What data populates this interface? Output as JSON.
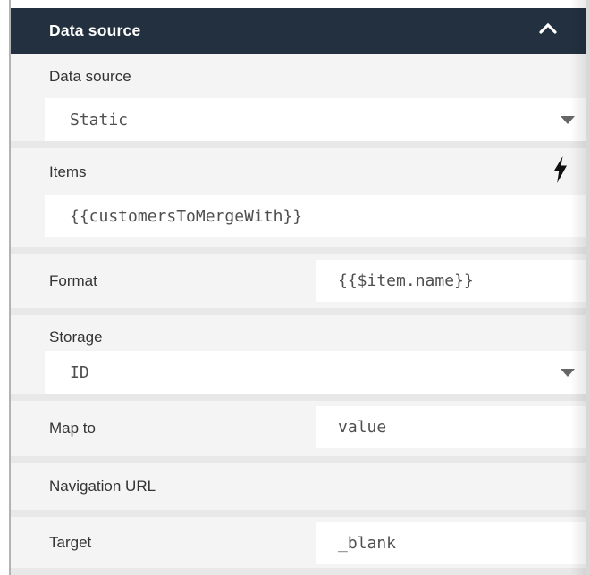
{
  "panel": {
    "header": {
      "title": "Data source",
      "icon": "chevron-up-icon"
    },
    "colors": {
      "header_bg": "#22303f",
      "header_text": "#ffffff",
      "body_bg": "#f4f4f4",
      "separator": "#e8e8e8",
      "input_bg": "#ffffff",
      "label_text": "#333333",
      "value_text": "#4f4f4f",
      "border_line": "#b3b3b3"
    },
    "fields": {
      "data_source": {
        "label": "Data source",
        "value": "Static",
        "control": "dropdown"
      },
      "items": {
        "label": "Items",
        "value": "{{customersToMergeWith}}",
        "control": "code-input",
        "icon": "lightning-bolt-icon"
      },
      "format": {
        "label": "Format",
        "value": "{{$item.name}}",
        "control": "code-input"
      },
      "storage": {
        "label": "Storage",
        "value": "ID",
        "control": "dropdown"
      },
      "map_to": {
        "label": "Map to",
        "value": "value",
        "control": "text-input"
      },
      "navigation_url": {
        "label": "Navigation URL",
        "value": "",
        "control": "none"
      },
      "target": {
        "label": "Target",
        "value": "_blank",
        "control": "text-input"
      }
    }
  }
}
